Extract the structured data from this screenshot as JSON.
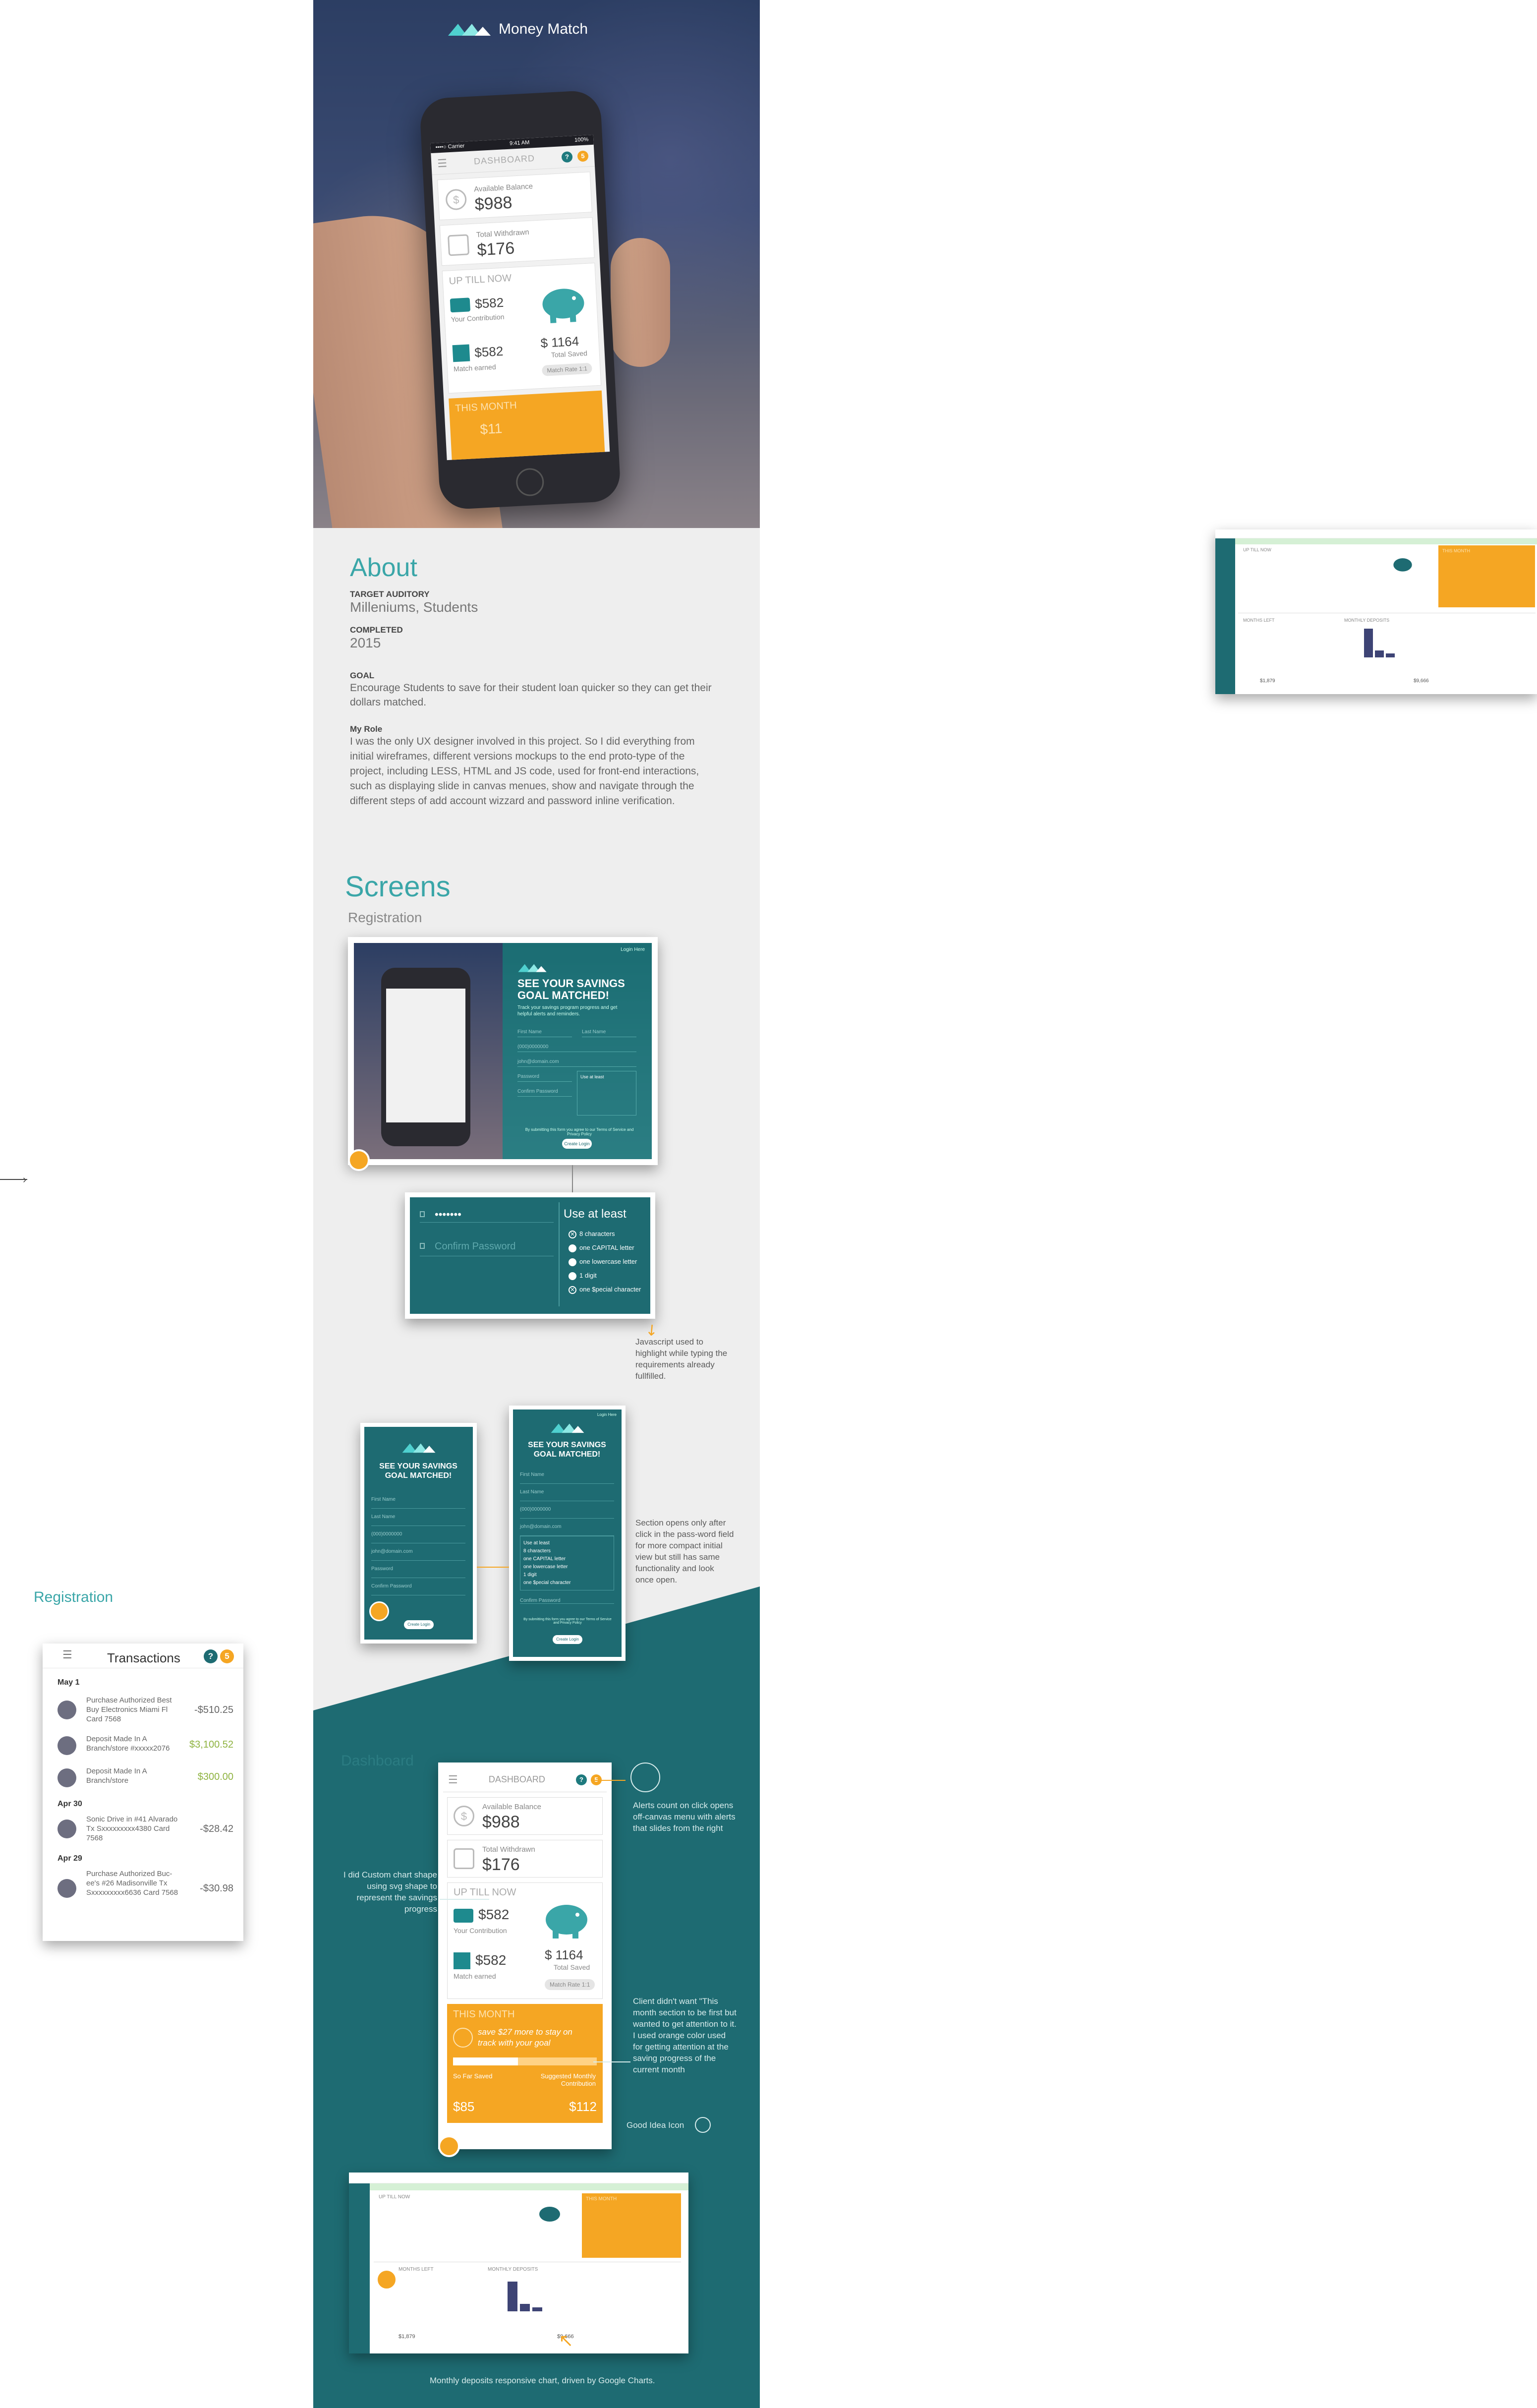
{
  "brand": {
    "name": "Money Match"
  },
  "colors": {
    "teal": "#1e6b72",
    "accent": "#3aa6a8",
    "orange": "#f5a623",
    "navy": "#2c3e63",
    "grey": "#eeeeee"
  },
  "hero_phone": {
    "carrier": "••••○ Carrier",
    "time": "9:41 AM",
    "battery": "100%",
    "title": "DASHBOARD",
    "badge_help": "?",
    "badge_alerts": "5",
    "available_label": "Available Balance",
    "available_value": "$988",
    "withdrawn_label": "Total Withdrawn",
    "withdrawn_value": "$176",
    "up_till_now": "UP TILL NOW",
    "contribution_value": "$582",
    "contribution_label": "Your Contribution",
    "match_value": "$582",
    "match_label": "Match earned",
    "total_value": "$ 1164",
    "total_label": "Total Saved",
    "match_rate": "Match Rate 1:1",
    "this_month": "THIS MONTH",
    "this_month_value": "$11"
  },
  "about": {
    "heading": "About",
    "target_label": "TARGET AUDITORY",
    "target_value": "Milleniums, Students",
    "completed_label": "COMPLETED",
    "completed_value": "2015",
    "goal_label": "GOAL",
    "goal_text": "Encourage Students to save for their student loan quicker so they can get their dollars matched.",
    "role_label": "My Role",
    "role_text": "I was the only UX designer involved in this project. So I did everything from initial wireframes, different versions mockups to the end proto-type of the project, including LESS, HTML and JS code, used for front-end interactions, such as displaying slide in canvas menues, show and navigate through the different steps of add account wizzard and password inline verification."
  },
  "screens": {
    "heading": "Screens",
    "registration_label": "Registration",
    "dashboard_label": "Dashboard"
  },
  "registration": {
    "headline": "SEE YOUR SAVINGS GOAL MATCHED!",
    "subtext": "Track your savings program progress and get helpful alerts and reminders.",
    "login_link": "Login Here",
    "fields": [
      "First Name",
      "Last Name",
      "(000)0000000",
      "john@domain.com",
      "Password",
      "Confirm Password"
    ],
    "use_at_least": "Use at least",
    "requirements": [
      "8 characters",
      "one CAPITAL letter",
      "one lowercase letter",
      "1 digit",
      "one $pecial character"
    ],
    "password_value": "•••••••",
    "confirm_placeholder": "Confirm Password",
    "terms": "By submitting this form you agree to our Terms of Service and Privacy Policy",
    "create_button": "Create Login"
  },
  "annotations": {
    "js_highlight": "Javascript used to highlight while typing the requirements already fullfilled.",
    "section_opens": "Section opens only after click in the pass-word field for more compact initial view but still has same functionality and look once open.",
    "alerts_count": "Alerts count on click opens off-canvas menu with alerts that slides from the right",
    "custom_chart": "I did Custom chart shape using svg shape to represent the savings progress",
    "client_wanted": "Client didn't want \"This month section to be first but wanted to get attention to it. I used orange color used for getting attention at the saving progress of the current month",
    "good_idea": "Good Idea Icon",
    "monthly_chart": "Monthly deposits responsive chart, driven by Google Charts."
  },
  "side": {
    "registration_label": "Registration"
  },
  "transactions": {
    "title": "Transactions",
    "badge_help": "?",
    "badge_alerts": "5",
    "groups": [
      {
        "date": "May 1",
        "rows": [
          {
            "desc": "Purchase Authorized Best Buy Electronics Miami Fl Card 7568",
            "amount": "-$510.25",
            "positive": false
          },
          {
            "desc": "Deposit Made In A Branch/store #xxxxx2076",
            "amount": "$3,100.52",
            "positive": true
          },
          {
            "desc": "Deposit Made In A Branch/store",
            "amount": "$300.00",
            "positive": true
          }
        ]
      },
      {
        "date": "Apr 30",
        "rows": [
          {
            "desc": "Sonic Drive in #41 Alvarado Tx Sxxxxxxxxx4380 Card 7568",
            "amount": "-$28.42",
            "positive": false
          }
        ]
      },
      {
        "date": "Apr 29",
        "rows": [
          {
            "desc": "Purchase Authorized Buc-ee's #26 Madisonville Tx Sxxxxxxxxx6636 Card 7568",
            "amount": "-$30.98",
            "positive": false
          }
        ]
      }
    ]
  },
  "dashboard_mobile": {
    "title": "DASHBOARD",
    "badge_help": "?",
    "badge_alerts": "5",
    "available_label": "Available Balance",
    "available_value": "$988",
    "withdrawn_label": "Total Withdrawn",
    "withdrawn_value": "$176",
    "up_till_now": "UP TILL NOW",
    "contribution_value": "$582",
    "contribution_label": "Your Contribution",
    "match_value": "$582",
    "match_label": "Match earned",
    "total_value": "$ 1164",
    "total_label": "Total Saved",
    "match_rate": "Match Rate 1:1",
    "this_month": "THIS MONTH",
    "this_month_msg": "save $27 more to stay on track with your goal",
    "so_far_label": "So Far Saved",
    "suggested_label": "Suggested Monthly Contribution",
    "so_far_value": "$85",
    "suggested_value": "$112",
    "progress_fraction": 0.45
  },
  "desktop_dashboard": {
    "up_till_now": "UP TILL NOW",
    "this_month": "THIS MONTH",
    "months_left": "MONTHS LEFT",
    "monthly_deposits": "MONTHLY DEPOSITS",
    "total_a": "$1,879",
    "total_b": "$9,666"
  }
}
